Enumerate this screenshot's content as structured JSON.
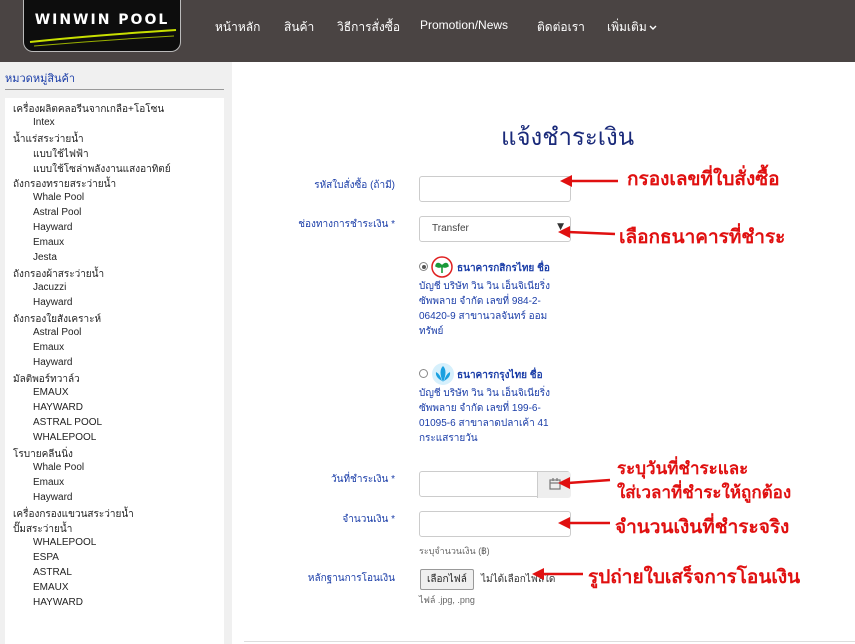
{
  "logo": {
    "text": "WINWIN POOL"
  },
  "nav": [
    "หน้าหลัก",
    "สินค้า",
    "วิธีการสั่งซื้อ",
    "Promotion/News",
    "ติดต่อเรา",
    "เพิ่มเติม"
  ],
  "sidebar": {
    "title": "หมวดหมู่สินค้า",
    "items": [
      {
        "label": "เครื่องผลิตคลอรีนจากเกลือ+โอโซน",
        "level": 0
      },
      {
        "label": "Intex",
        "level": 1
      },
      {
        "label": "น้ำแร่สระว่ายน้ำ",
        "level": 0
      },
      {
        "label": "แบบใช้ไฟฟ้า",
        "level": 1
      },
      {
        "label": "แบบใช้โซล่าพลังงานแสงอาทิตย์",
        "level": 1
      },
      {
        "label": "ถังกรองทรายสระว่ายน้ำ",
        "level": 0
      },
      {
        "label": "Whale Pool",
        "level": 1
      },
      {
        "label": "Astral Pool",
        "level": 1
      },
      {
        "label": "Hayward",
        "level": 1
      },
      {
        "label": "Emaux",
        "level": 1
      },
      {
        "label": "Jesta",
        "level": 1
      },
      {
        "label": "ถังกรองผ้าสระว่ายน้ำ",
        "level": 0
      },
      {
        "label": "Jacuzzi",
        "level": 1
      },
      {
        "label": "Hayward",
        "level": 1
      },
      {
        "label": "ถังกรองใยสังเคราะห์",
        "level": 0
      },
      {
        "label": "Astral Pool",
        "level": 1
      },
      {
        "label": "Emaux",
        "level": 1
      },
      {
        "label": "Hayward",
        "level": 1
      },
      {
        "label": "มัลติพอร์ทวาล์ว",
        "level": 0
      },
      {
        "label": "EMAUX",
        "level": 1
      },
      {
        "label": "HAYWARD",
        "level": 1
      },
      {
        "label": "ASTRAL POOL",
        "level": 1
      },
      {
        "label": "WHALEPOOL",
        "level": 1
      },
      {
        "label": "โรบายคลีนนิ่ง",
        "level": 0
      },
      {
        "label": "Whale Pool",
        "level": 1
      },
      {
        "label": "Emaux",
        "level": 1
      },
      {
        "label": "Hayward",
        "level": 1
      },
      {
        "label": "เครื่องกรองแขวนสระว่ายน้ำ",
        "level": 0
      },
      {
        "label": "ปั๊มสระว่ายน้ำ",
        "level": 0
      },
      {
        "label": "WHALEPOOL",
        "level": 1
      },
      {
        "label": "ESPA",
        "level": 1
      },
      {
        "label": "ASTRAL",
        "level": 1
      },
      {
        "label": "EMAUX",
        "level": 1
      },
      {
        "label": "HAYWARD",
        "level": 1
      }
    ]
  },
  "form": {
    "title": "แจ้งชำระเงิน",
    "order_label": "รหัสใบสั่งซื้อ (ถ้ามี)",
    "method_label": "ช่องทางการชำระเงิน *",
    "method_value": "Transfer",
    "banks": [
      {
        "name": "ธนาคารกสิกรไทย ชื่อ",
        "detail": "บัญชี บริษัท วิน วิน เอ็นจิเนียริ่ง ซัพพลาย จำกัด เลขที่ 984-2-06420-9 สาขานวลจันทร์ ออมทรัพย์",
        "selected": true,
        "color": "#1a9a3a"
      },
      {
        "name": "ธนาคารกรุงไทย ชื่อ",
        "detail": "บัญชี บริษัท วิน วิน เอ็นจิเนียริ่ง ซัพพลาย จำกัด เลขที่ 199-6-01095-6 สาขาลาดปลาเค้า 41 กระแสรายวัน",
        "selected": false,
        "color": "#1aa0e0"
      }
    ],
    "date_label": "วันที่ชำระเงิน *",
    "amount_label": "จำนวนเงิน *",
    "amount_hint": "ระบุจำนวนเงิน (฿)",
    "proof_label": "หลักฐานการโอนเงิน",
    "file_button": "เลือกไฟล์",
    "file_none": "ไม่ได้เลือกไฟล์ใด",
    "file_hint": "ไฟล์ .jpg, .png"
  },
  "annotations": {
    "a1": "กรองเลขที่ใบสั่งซื้อ",
    "a2": "เลือกธนาคารที่ชำระ",
    "a3_line1": "ระบุวันที่ชำระและ",
    "a3_line2": "ใส่เวลาที่ชำระให้ถูกต้อง",
    "a4": "จำนวนเงินที่ชำระจริง",
    "a5": "รูปถ่ายใบเสร็จการโอนเงิน",
    "color": "#e01010"
  }
}
